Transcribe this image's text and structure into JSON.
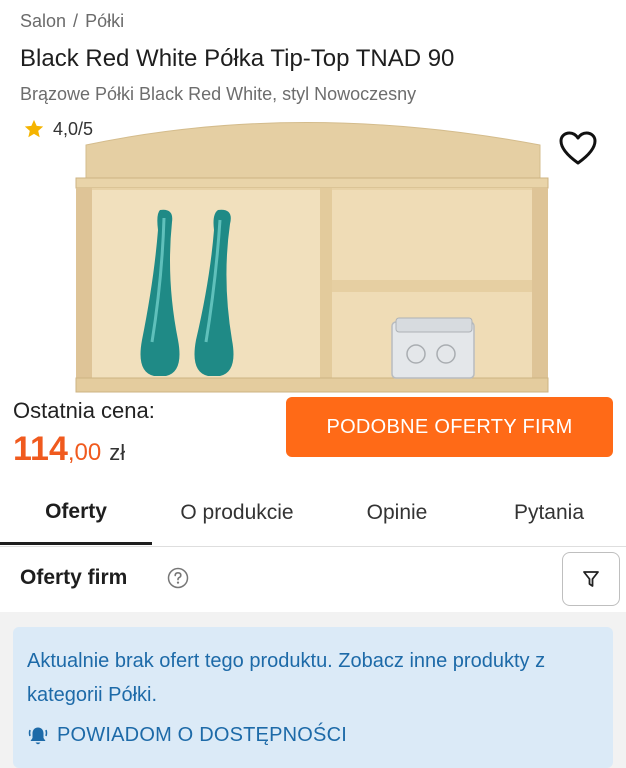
{
  "breadcrumb": {
    "home": "Salon",
    "separator": "/",
    "category": "Półki"
  },
  "product": {
    "title": "Black Red White Półka Tip-Top TNAD 90",
    "subtitle": "Brązowe Półki Black Red White, styl Nowoczesny",
    "rating": "4,0/5",
    "rating_value": 4.0
  },
  "price": {
    "label": "Ostatnia cena:",
    "integer": "114",
    "decimal": ",00",
    "currency": "zł"
  },
  "cta": {
    "label": "PODOBNE OFERTY FIRM"
  },
  "tabs": [
    {
      "label": "Oferty",
      "active": true
    },
    {
      "label": "O produkcie",
      "active": false
    },
    {
      "label": "Opinie",
      "active": false
    },
    {
      "label": "Pytania",
      "active": false
    }
  ],
  "offers": {
    "title": "Oferty firm",
    "info": "Aktualnie brak ofert tego produktu. Zobacz inne produkty z kategorii Półki.",
    "notify_label": "POWIADOM O DOSTĘPNOŚCI"
  },
  "icons": {
    "star": "star-icon",
    "favorite": "heart-icon",
    "help": "question-icon",
    "filter": "filter-icon",
    "bell": "bell-icon"
  },
  "colors": {
    "accent": "#ff6a17",
    "price": "#f05a1e",
    "info_bg": "#dbeaf7",
    "info_text": "#1d6aa8",
    "star": "#f5b400"
  }
}
